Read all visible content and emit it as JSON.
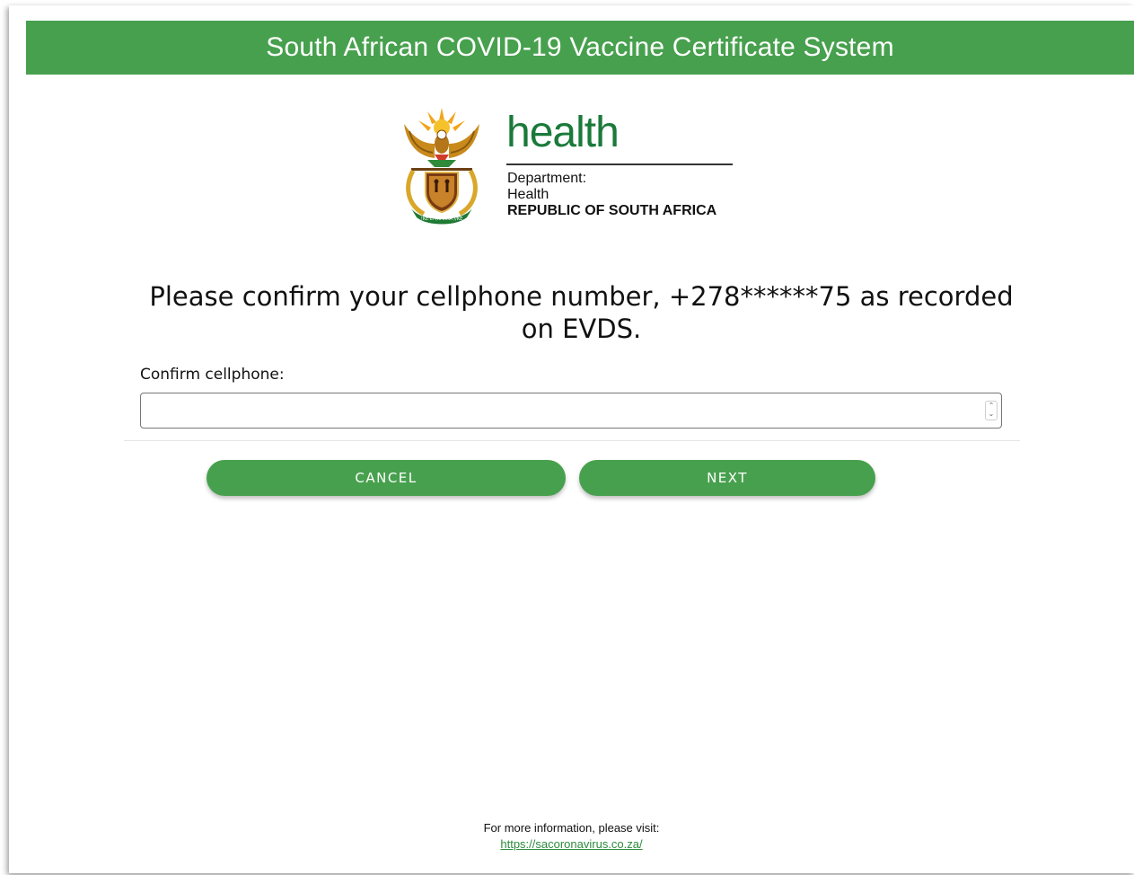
{
  "header": {
    "title": "South African COVID-19 Vaccine Certificate System",
    "bg_color": "#47a04d"
  },
  "logo": {
    "crest_icon": "coat-of-arms-icon",
    "health_word": "health",
    "dept_line1": "Department:",
    "dept_line2": "Health",
    "dept_line3": "REPUBLIC OF SOUTH AFRICA",
    "health_color": "#1a7a3a"
  },
  "main": {
    "prompt": "Please confirm your cellphone number, +278******75 as recorded on EVDS.",
    "field_label": "Confirm cellphone:",
    "field_value": "",
    "field_placeholder": ""
  },
  "actions": {
    "cancel_label": "CANCEL",
    "next_label": "NEXT",
    "button_color": "#47a04d"
  },
  "footer": {
    "info_text": "For more information, please visit:",
    "link_text": "https://sacoronavirus.co.za/"
  }
}
